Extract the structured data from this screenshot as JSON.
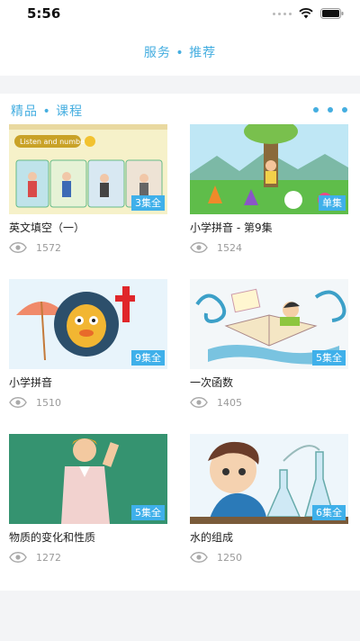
{
  "status_bar": {
    "time": "5:56"
  },
  "nav": {
    "title": "服务 • 推荐"
  },
  "section": {
    "title": "精品 • 课程"
  },
  "courses": [
    {
      "title": "英文填空（一）",
      "badge": "3集全",
      "views": "1572",
      "thumb_text": "Listen and number."
    },
    {
      "title": "小学拼音 - 第9集",
      "badge": "单集",
      "views": "1524"
    },
    {
      "title": "小学拼音",
      "badge": "9集全",
      "views": "1510"
    },
    {
      "title": "一次函数",
      "badge": "5集全",
      "views": "1405"
    },
    {
      "title": "物质的变化和性质",
      "badge": "5集全",
      "views": "1272"
    },
    {
      "title": "水的组成",
      "badge": "6集全",
      "views": "1250"
    }
  ],
  "colors": {
    "accent": "#45aee0",
    "badge": "#3fb0ea",
    "background": "#f3f4f6"
  }
}
